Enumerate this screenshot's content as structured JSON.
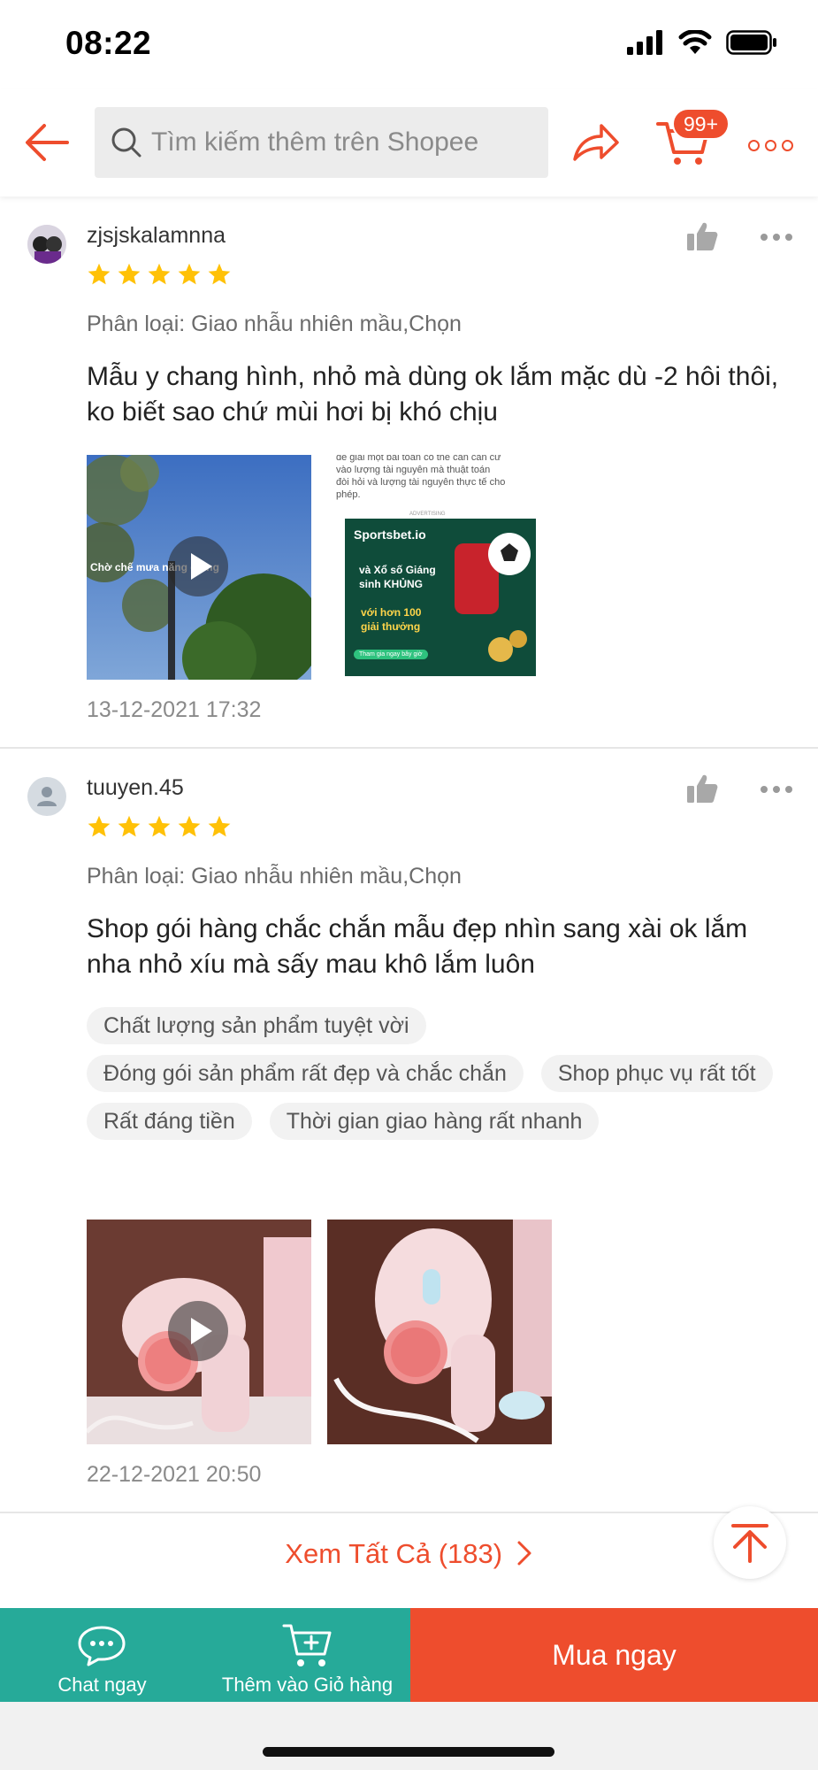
{
  "status_bar": {
    "time": "08:22"
  },
  "header": {
    "search_placeholder": "Tìm kiếm thêm trên Shopee",
    "cart_badge": "99+"
  },
  "colors": {
    "brand": "#ee4d2d",
    "teal": "#26aa99",
    "star": "#ffc107"
  },
  "reviews": [
    {
      "username": "zjsjskalamnna",
      "rating": 5,
      "variant": "Phân loại: Giao nhẫu nhiên mầu,Chọn",
      "comment": "Mẫu y chang hình, nhỏ mà dùng ok lắm mặc dù -2 hôi thôi, ko biết sao chứ mùi hơi bị khó chịu",
      "media": [
        {
          "type": "video",
          "overlay_text": "Chờ chế mưa năng giông",
          "icon": "play-icon"
        },
        {
          "type": "image",
          "article_lines": [
            "đề giải một bài toán có thể cần cân cứ",
            "vào lượng tài nguyên mà thuật toán",
            "đòi hỏi và lượng tài nguyên thực tế cho",
            "phép."
          ],
          "ad_label": "ADVERTISING",
          "ad_brand": "Sportsbet.io",
          "ad_headline": "và Xổ số Giáng sinh KHỦNG",
          "ad_sub": "với hơn 100 giải thưởng",
          "ad_cta": "Tham gia ngay bây giờ"
        }
      ],
      "date": "13-12-2021 17:32"
    },
    {
      "username": "tuuyen.45",
      "rating": 5,
      "variant": "Phân loại: Giao nhẫu nhiên mầu,Chọn",
      "comment": "Shop gói hàng chắc chắn mẫu đẹp nhìn sang xài ok lắm nha nhỏ xíu mà sấy mau khô lắm luôn",
      "tags": [
        "Chất lượng sản phẩm tuyệt vời",
        "Đóng gói sản phẩm rất đẹp và chắc chắn",
        "Shop phục vụ rất tốt",
        "Rất đáng tiền",
        "Thời gian giao hàng rất nhanh"
      ],
      "media": [
        {
          "type": "video",
          "icon": "play-icon"
        },
        {
          "type": "image"
        }
      ],
      "date": "22-12-2021 20:50"
    }
  ],
  "see_all": "Xem Tất Cả (183)",
  "bottom_bar": {
    "chat_label": "Chat ngay",
    "add_cart_label": "Thêm vào Giỏ hàng",
    "buy_label": "Mua ngay"
  }
}
